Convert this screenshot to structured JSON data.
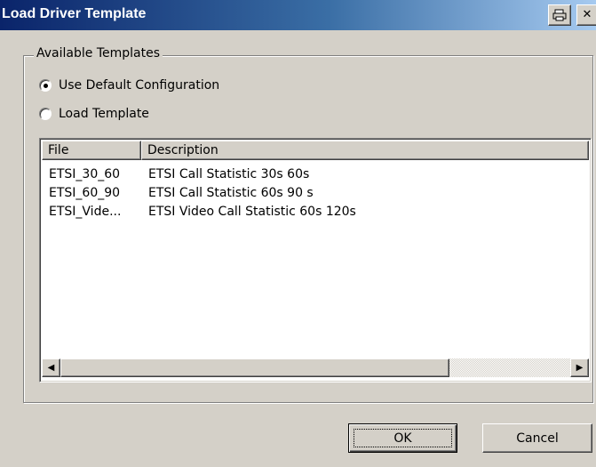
{
  "window": {
    "title": "Load Driver Template",
    "print_icon": "printer-icon",
    "close_glyph": "✕",
    "colors": {
      "title_start": "#0a246a",
      "title_end": "#a6caf0",
      "face": "#d4d0c8"
    }
  },
  "group": {
    "label": "Available Templates",
    "options": [
      {
        "label": "Use Default Configuration",
        "selected": true
      },
      {
        "label": "Load Template",
        "selected": false
      }
    ]
  },
  "list": {
    "columns": [
      "File",
      "Description"
    ],
    "rows": [
      {
        "file": "ETSI_30_60",
        "description": "ETSI Call Statistic 30s 60s"
      },
      {
        "file": "ETSI_60_90",
        "description": "ETSI Call Statistic 60s 90 s"
      },
      {
        "file": "ETSI_Vide...",
        "description": "ETSI Video Call Statistic 60s 120s"
      }
    ],
    "scroll_left_glyph": "◀",
    "scroll_right_glyph": "▶"
  },
  "buttons": {
    "ok": "OK",
    "cancel": "Cancel"
  }
}
